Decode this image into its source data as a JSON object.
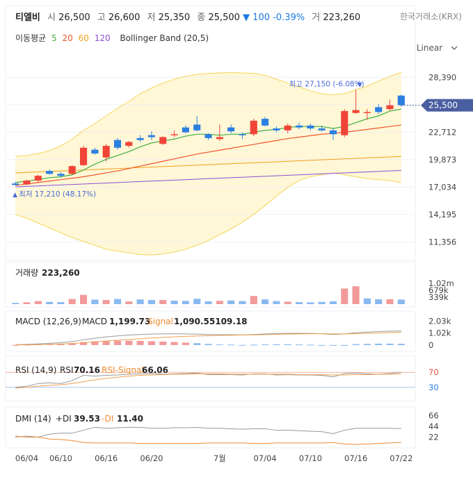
{
  "header": {
    "name": "티엘비",
    "open_label": "시",
    "open": "26,500",
    "high_label": "고",
    "high": "26,600",
    "low_label": "저",
    "low": "25,350",
    "close_label": "종",
    "close": "25,500",
    "change_arrow": "▼",
    "change": "100 -0.39%",
    "volume_label": "거",
    "volume": "223,260"
  },
  "source": "한국거래소(KRX)",
  "ma_legend": {
    "label": "이동평균",
    "periods": [
      {
        "text": "5",
        "color": "#3fae3f"
      },
      {
        "text": "20",
        "color": "#f2552c"
      },
      {
        "text": "60",
        "color": "#f0a01a"
      },
      {
        "text": "120",
        "color": "#8a4fd8"
      }
    ],
    "bollinger": "Bollinger Band (20,5)"
  },
  "scale_toggle": {
    "label": "Linear",
    "icon": "chevron-down-icon"
  },
  "colors": {
    "up": "#f04438",
    "down": "#2b7fe0",
    "band_fill": "#fff7d6",
    "band_line": "#f5d55b",
    "price_tag": "#4a5fa0"
  },
  "chart_data": [
    {
      "type": "candlestick",
      "ylim": [
        9800,
        30500
      ],
      "y_ticks": [
        "28,390",
        "25,551",
        "22,712",
        "19,873",
        "17,034",
        "14,195",
        "11,356"
      ],
      "y_tick_values": [
        28390,
        25551,
        22712,
        19873,
        17034,
        14195,
        11356
      ],
      "x_ticks": [
        "06/04",
        "06/10",
        "06/16",
        "06/20",
        "7월",
        "07/04",
        "07/10",
        "07/16",
        "07/22"
      ],
      "x_tick_index": [
        1,
        4,
        8,
        12,
        18,
        22,
        26,
        30,
        34
      ],
      "candles": [
        {
          "o": 17400,
          "h": 17550,
          "l": 17210,
          "c": 17250
        },
        {
          "o": 17300,
          "h": 17800,
          "l": 17250,
          "c": 17700
        },
        {
          "o": 17700,
          "h": 18300,
          "l": 17500,
          "c": 18200
        },
        {
          "o": 18700,
          "h": 18850,
          "l": 18300,
          "c": 18400
        },
        {
          "o": 18400,
          "h": 18600,
          "l": 18000,
          "c": 18200
        },
        {
          "o": 18400,
          "h": 19300,
          "l": 18300,
          "c": 19200
        },
        {
          "o": 19300,
          "h": 21300,
          "l": 19200,
          "c": 21100
        },
        {
          "o": 20900,
          "h": 21100,
          "l": 20400,
          "c": 20500
        },
        {
          "o": 20100,
          "h": 21500,
          "l": 19700,
          "c": 21300
        },
        {
          "o": 21900,
          "h": 22100,
          "l": 20900,
          "c": 21100
        },
        {
          "o": 21300,
          "h": 21800,
          "l": 21100,
          "c": 21700
        },
        {
          "o": 22100,
          "h": 22400,
          "l": 21700,
          "c": 21900
        },
        {
          "o": 22400,
          "h": 22800,
          "l": 21900,
          "c": 22200
        },
        {
          "o": 21500,
          "h": 22300,
          "l": 21400,
          "c": 22200
        },
        {
          "o": 22500,
          "h": 22900,
          "l": 22200,
          "c": 22500
        },
        {
          "o": 23200,
          "h": 23400,
          "l": 22600,
          "c": 22700
        },
        {
          "o": 23500,
          "h": 24400,
          "l": 22800,
          "c": 22900
        },
        {
          "o": 22500,
          "h": 22600,
          "l": 21900,
          "c": 22100
        },
        {
          "o": 22000,
          "h": 23500,
          "l": 21800,
          "c": 22200
        },
        {
          "o": 23200,
          "h": 23500,
          "l": 22600,
          "c": 22800
        },
        {
          "o": 22500,
          "h": 22700,
          "l": 22000,
          "c": 22400
        },
        {
          "o": 22500,
          "h": 24100,
          "l": 22300,
          "c": 23900
        },
        {
          "o": 24100,
          "h": 24300,
          "l": 23300,
          "c": 23400
        },
        {
          "o": 23100,
          "h": 23300,
          "l": 22700,
          "c": 22900
        },
        {
          "o": 22900,
          "h": 23600,
          "l": 22600,
          "c": 23400
        },
        {
          "o": 23400,
          "h": 23700,
          "l": 23000,
          "c": 23200
        },
        {
          "o": 23400,
          "h": 23600,
          "l": 22900,
          "c": 23100
        },
        {
          "o": 23100,
          "h": 23400,
          "l": 22800,
          "c": 22900
        },
        {
          "o": 22900,
          "h": 23100,
          "l": 21900,
          "c": 22500
        },
        {
          "o": 22400,
          "h": 25100,
          "l": 22200,
          "c": 24900
        },
        {
          "o": 24700,
          "h": 27150,
          "l": 24600,
          "c": 25000
        },
        {
          "o": 24700,
          "h": 25100,
          "l": 24000,
          "c": 24800
        },
        {
          "o": 25300,
          "h": 25600,
          "l": 24600,
          "c": 24800
        },
        {
          "o": 25100,
          "h": 26100,
          "l": 24900,
          "c": 25500
        },
        {
          "o": 26500,
          "h": 26600,
          "l": 25350,
          "c": 25500
        }
      ],
      "ma5": [
        17500,
        17650,
        17800,
        18000,
        18100,
        18300,
        18800,
        19400,
        19900,
        20300,
        20700,
        21200,
        21600,
        21800,
        22000,
        22300,
        22500,
        22500,
        22400,
        22500,
        22500,
        22700,
        22900,
        23000,
        23200,
        23300,
        23300,
        23300,
        23100,
        23300,
        23700,
        24100,
        24400,
        24900,
        25100
      ],
      "ma20": [
        17200,
        17350,
        17500,
        17650,
        17800,
        17950,
        18100,
        18300,
        18500,
        18700,
        18950,
        19200,
        19450,
        19700,
        19950,
        20200,
        20450,
        20650,
        20850,
        21050,
        21250,
        21450,
        21650,
        21850,
        22050,
        22200,
        22350,
        22500,
        22600,
        22700,
        22850,
        23000,
        23150,
        23300,
        23450
      ],
      "ma60": [
        18500,
        18550,
        18600,
        18650,
        18700,
        18750,
        18800,
        18850,
        18900,
        18950,
        19000,
        19050,
        19100,
        19150,
        19200,
        19250,
        19300,
        19350,
        19400,
        19450,
        19500,
        19550,
        19600,
        19650,
        19700,
        19750,
        19800,
        19850,
        19900,
        19950,
        20000,
        20050,
        20100,
        20150,
        20200
      ],
      "ma120": [
        17050,
        17100,
        17150,
        17200,
        17250,
        17300,
        17350,
        17400,
        17450,
        17500,
        17550,
        17600,
        17650,
        17700,
        17750,
        17800,
        17850,
        17900,
        17950,
        18000,
        18050,
        18100,
        18150,
        18200,
        18250,
        18300,
        18350,
        18400,
        18450,
        18500,
        18550,
        18600,
        18650,
        18700,
        18750
      ],
      "bb_upper": [
        20200,
        20300,
        20500,
        20800,
        21300,
        22000,
        22900,
        23600,
        24400,
        25200,
        25900,
        26700,
        27300,
        27800,
        28200,
        28500,
        28700,
        28800,
        28850,
        28900,
        28850,
        28800,
        28600,
        28200,
        27800,
        27400,
        27000,
        26700,
        26600,
        26700,
        27100,
        27500,
        28000,
        28500,
        28900
      ],
      "bb_lower": [
        14200,
        13800,
        13300,
        12800,
        12300,
        11800,
        11400,
        11000,
        10600,
        10400,
        10200,
        10050,
        10000,
        10100,
        10300,
        10600,
        11000,
        11500,
        12100,
        12700,
        13400,
        14200,
        15100,
        16100,
        17000,
        17700,
        18100,
        18300,
        18500,
        18300,
        18100,
        17900,
        17800,
        17700,
        17500
      ],
      "high_label": "최고 27,150 (-6.08%)",
      "high_marker": "▼",
      "low_label": "최저 17,210 (48.17%)",
      "low_marker": "▲",
      "last_price_tag": "25,500"
    },
    {
      "type": "bar",
      "title": "거래량",
      "value": "223,260",
      "y_ticks": [
        "1.02m",
        "679k",
        "339k"
      ],
      "y_tick_values": [
        1020000,
        679000,
        339000
      ],
      "ylim": [
        0,
        1150000
      ],
      "values": [
        60000,
        90000,
        150000,
        110000,
        100000,
        250000,
        450000,
        220000,
        200000,
        250000,
        130000,
        230000,
        200000,
        200000,
        170000,
        160000,
        260000,
        140000,
        160000,
        180000,
        150000,
        400000,
        230000,
        150000,
        120000,
        100000,
        90000,
        110000,
        140000,
        760000,
        870000,
        280000,
        240000,
        240000,
        223260
      ],
      "up": [
        0,
        1,
        1,
        0,
        0,
        1,
        1,
        0,
        1,
        0,
        1,
        0,
        0,
        1,
        0,
        0,
        0,
        0,
        1,
        0,
        0,
        1,
        0,
        0,
        1,
        0,
        0,
        0,
        0,
        1,
        1,
        0,
        0,
        1,
        0
      ]
    },
    {
      "type": "bar-line",
      "title": "MACD (12,26,9)",
      "macd_label": "MACD",
      "macd_value": "1,199.73",
      "signal_label": "Signal",
      "signal_value": "1,090.55109.18",
      "y_ticks": [
        "2.03k",
        "1.02k",
        "0"
      ],
      "y_tick_values": [
        2030,
        1020,
        0
      ],
      "ylim": [
        -300,
        2300
      ],
      "macd": [
        30,
        60,
        100,
        150,
        200,
        300,
        450,
        580,
        700,
        780,
        850,
        900,
        930,
        950,
        960,
        950,
        930,
        900,
        880,
        880,
        870,
        900,
        950,
        980,
        1000,
        1000,
        990,
        960,
        900,
        950,
        1050,
        1100,
        1150,
        1180,
        1199.73
      ],
      "signal": [
        20,
        30,
        40,
        60,
        90,
        130,
        200,
        270,
        340,
        410,
        480,
        540,
        600,
        650,
        700,
        740,
        770,
        800,
        820,
        840,
        860,
        870,
        890,
        910,
        930,
        950,
        960,
        960,
        950,
        950,
        970,
        1000,
        1030,
        1060,
        1090.55
      ],
      "hist": [
        10,
        30,
        60,
        90,
        110,
        170,
        250,
        310,
        360,
        370,
        370,
        360,
        330,
        300,
        260,
        210,
        160,
        100,
        60,
        40,
        10,
        30,
        60,
        70,
        70,
        50,
        30,
        0,
        -50,
        0,
        80,
        100,
        120,
        120,
        109.18
      ]
    },
    {
      "type": "line",
      "title": "RSI (14,9)",
      "rsi_label": "RSI",
      "rsi_value": "70.16",
      "signal_label": "RSI-Signal",
      "signal_value": "66.06",
      "y_ticks": [
        "70",
        "30"
      ],
      "y_tick_values": [
        70,
        30
      ],
      "ylim": [
        0,
        100
      ],
      "rsi": [
        30,
        33,
        40,
        42,
        40,
        48,
        62,
        60,
        62,
        63,
        65,
        66,
        67,
        65,
        66,
        67,
        68,
        64,
        64,
        64,
        63,
        66,
        66,
        63,
        64,
        63,
        63,
        62,
        58,
        67,
        68,
        66,
        65,
        67,
        70.16
      ],
      "signal": [
        28,
        30,
        33,
        35,
        37,
        40,
        45,
        50,
        54,
        57,
        60,
        62,
        63,
        64,
        65,
        65,
        66,
        66,
        66,
        65,
        65,
        65,
        65,
        65,
        65,
        64,
        64,
        64,
        63,
        63,
        64,
        64,
        65,
        65,
        66.06
      ]
    },
    {
      "type": "line",
      "title": "DMI (14)",
      "pdi_label": "+DI",
      "pdi_value": "39.53",
      "mdi_label": "-DI",
      "mdi_value": "11.40",
      "y_ticks": [
        "66",
        "44",
        "22"
      ],
      "y_tick_values": [
        66,
        44,
        22
      ],
      "ylim": [
        0,
        75
      ],
      "pdi": [
        22,
        24,
        22,
        28,
        30,
        30,
        36,
        42,
        40,
        41,
        42,
        42,
        40,
        40,
        41,
        41,
        42,
        40,
        40,
        39,
        38,
        39,
        39,
        36,
        36,
        35,
        34,
        33,
        29,
        36,
        40,
        40,
        40,
        40,
        39.53
      ],
      "mdi": [
        24,
        22,
        22,
        18,
        17,
        15,
        11,
        10,
        10,
        10,
        10,
        9,
        9,
        9,
        9,
        9,
        9,
        10,
        10,
        10,
        10,
        9,
        9,
        10,
        10,
        10,
        10,
        10,
        11,
        8,
        7,
        8,
        9,
        10,
        11.4
      ]
    }
  ]
}
